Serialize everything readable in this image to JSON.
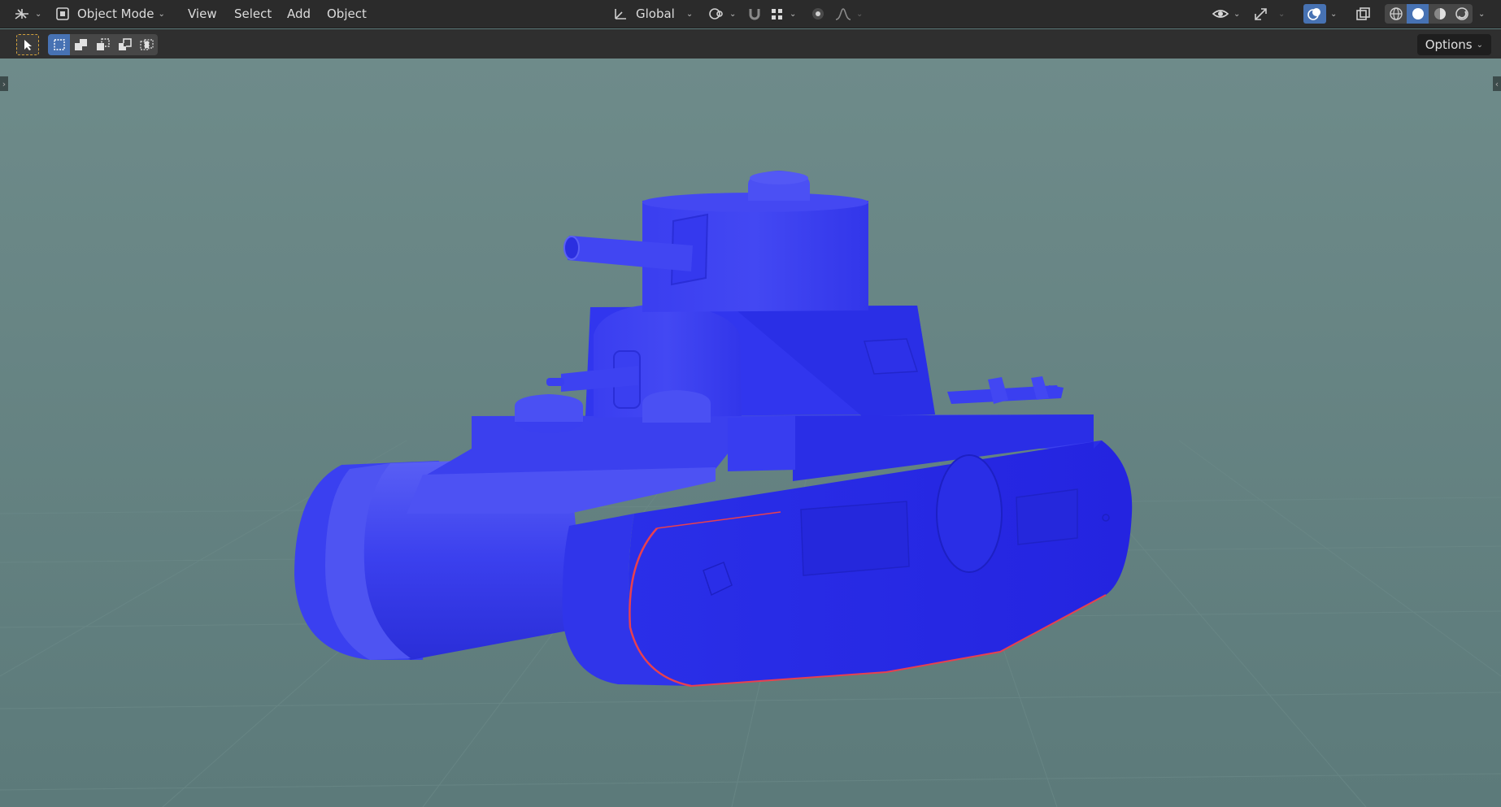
{
  "header": {
    "mode_label": "Object Mode",
    "menus": [
      "View",
      "Select",
      "Add",
      "Object"
    ],
    "transform_orientation": "Global"
  },
  "toolbar": {
    "options_label": "Options"
  },
  "viewport": {
    "object": "tank-model",
    "shading": "solid",
    "background_color": "#5f7d7d",
    "object_color": "#2b2ef0",
    "outline_color": "#e04040"
  }
}
